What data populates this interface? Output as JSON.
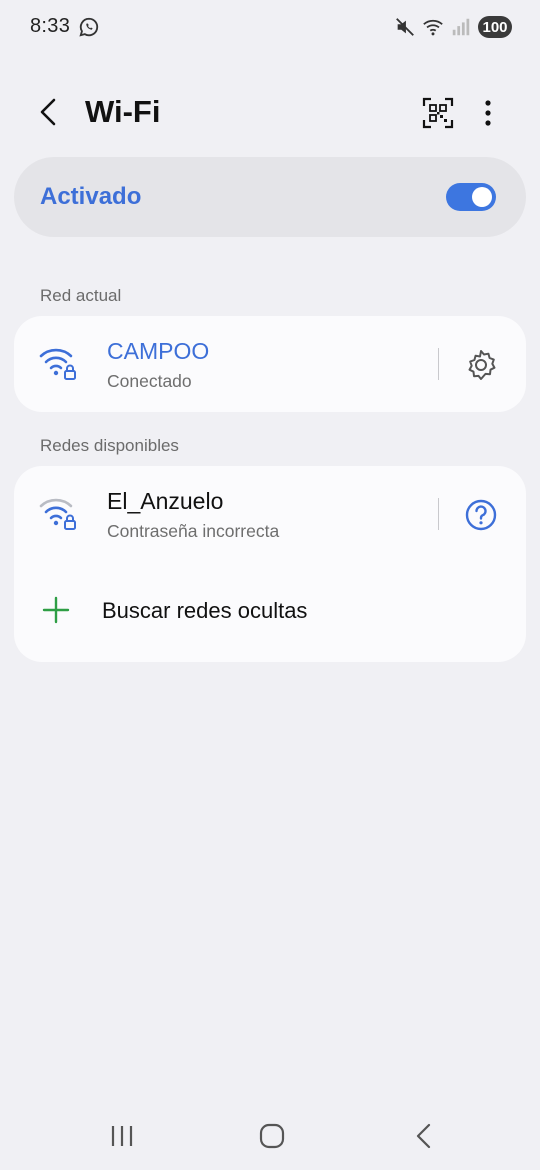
{
  "status_bar": {
    "time": "8:33",
    "battery": "100",
    "icons": [
      "whatsapp-icon",
      "mute-icon",
      "wifi-icon",
      "signal-icon"
    ]
  },
  "header": {
    "title": "Wi-Fi",
    "icons": [
      "back-arrow-icon",
      "qr-code-icon",
      "more-options-icon"
    ]
  },
  "master_toggle": {
    "label": "Activado",
    "on": true,
    "accent": "#3d6fd8"
  },
  "current_network": {
    "section_label": "Red actual",
    "name": "CAMPOO",
    "status": "Conectado",
    "action_icon": "gear-icon",
    "name_color": "#3d6fd8"
  },
  "available_networks": {
    "section_label": "Redes disponibles",
    "items": [
      {
        "name": "El_Anzuelo",
        "status": "Contraseña incorrecta",
        "action_icon": "help-icon"
      }
    ],
    "add_hidden_label": "Buscar redes ocultas",
    "add_icon": "plus-icon",
    "add_color": "#2e9e45"
  },
  "nav_bar": {
    "icons": [
      "recent-apps-icon",
      "home-icon",
      "back-icon"
    ]
  }
}
